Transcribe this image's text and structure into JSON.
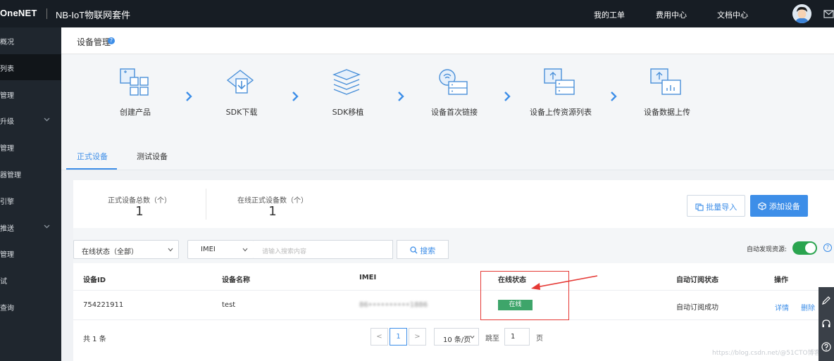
{
  "topbar": {
    "logo": "OneNET",
    "product": "NB-IoT物联网套件",
    "nav": [
      "我的工单",
      "费用中心",
      "文档中心"
    ]
  },
  "sidebar": {
    "items": [
      {
        "label": "概况"
      },
      {
        "label": "列表"
      },
      {
        "label": "管理"
      },
      {
        "label": "升级"
      },
      {
        "label": "管理"
      },
      {
        "label": "器管理"
      },
      {
        "label": "引擎"
      },
      {
        "label": "推送"
      },
      {
        "label": "管理"
      },
      {
        "label": "试"
      },
      {
        "label": "查询"
      }
    ]
  },
  "page": {
    "title": "设备管理",
    "help_icon": "?"
  },
  "steps": [
    {
      "label": "创建产品",
      "icon": "grid-icon"
    },
    {
      "label": "SDK下载",
      "icon": "download-icon"
    },
    {
      "label": "SDK移植",
      "icon": "layers-icon"
    },
    {
      "label": "设备首次链接",
      "icon": "link-device-icon"
    },
    {
      "label": "设备上传资源列表",
      "icon": "upload-list-icon"
    },
    {
      "label": "设备数据上传",
      "icon": "data-upload-icon"
    }
  ],
  "tabs": [
    {
      "label": "正式设备",
      "active": true
    },
    {
      "label": "测试设备",
      "active": false
    }
  ],
  "summary": {
    "total_label": "正式设备总数（个）",
    "total_value": "1",
    "online_label": "在线正式设备数（个）",
    "online_value": "1",
    "import_button": "批量导入",
    "add_button": "添加设备"
  },
  "filters": {
    "status_select": "在线状态（全部）",
    "field_select": "IMEI",
    "search_placeholder": "请输入搜索内容",
    "search_button": "搜索",
    "auto_discover_label": "自动发现资源:",
    "auto_discover_on": true
  },
  "table": {
    "headers": [
      "设备ID",
      "设备名称",
      "IMEI",
      "在线状态",
      "自动订阅状态",
      "操作"
    ],
    "rows": [
      {
        "device_id": "754221911",
        "name": "test",
        "imei": "86••••••••••1886",
        "status": "在线",
        "subscribe": "自动订阅成功",
        "actions": [
          "详情",
          "删除"
        ]
      }
    ]
  },
  "pagination": {
    "total": "共 1 条",
    "prev": "<",
    "current": "1",
    "next": ">",
    "page_size": "10 条/页",
    "goto_label": "跳至",
    "goto_value": "1",
    "page_unit": "页"
  },
  "watermark": "https://blog.csdn.net/@51CTO博客",
  "colors": {
    "accent": "#3d8ee8",
    "topbar": "#171d24",
    "sidebar": "#1f262e",
    "online": "#3ea56a",
    "toggle": "#2aa44f",
    "annotation": "#e53935"
  }
}
